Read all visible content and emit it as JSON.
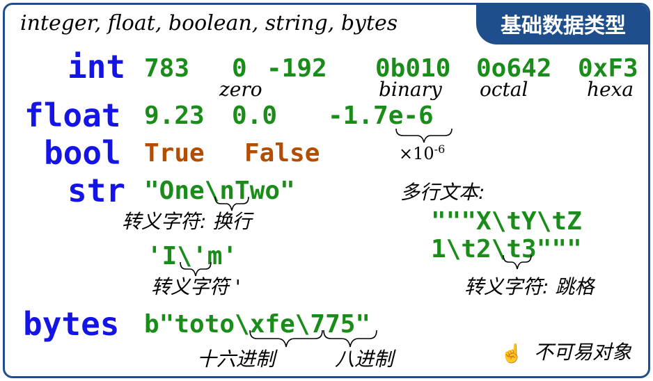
{
  "header": {
    "types_list": "integer, float, boolean, string, bytes",
    "badge": "基础数据类型"
  },
  "int": {
    "keyword": "int",
    "values": [
      "783",
      "0",
      "-192",
      "0b010",
      "0o642",
      "0xF3"
    ],
    "labels": {
      "zero": "zero",
      "binary": "binary",
      "octal": "octal",
      "hexa": "hexa"
    }
  },
  "float": {
    "keyword": "float",
    "values": [
      "9.23",
      "0.0",
      "-1.7e-6"
    ],
    "exp_note": "×10",
    "exp_power": "-6"
  },
  "bool": {
    "keyword": "bool",
    "values": [
      "True",
      "False"
    ]
  },
  "str": {
    "keyword": "str",
    "example1": "\"One\\nTwo\"",
    "note1": "转义字符: 换行",
    "example2": "'I\\'m'",
    "note2": "转义字符 '",
    "multiline_label": "多行文本:",
    "multiline_line1": "\"\"\"X\\tY\\tZ",
    "multiline_line2": "1\\t2\\t3\"\"\"",
    "note3": "转义字符: 跳格"
  },
  "bytes": {
    "keyword": "bytes",
    "value": "b\"toto\\xfe\\775\"",
    "note_hex": "十六进制",
    "note_oct": "八进制",
    "immutable": "不可易对象",
    "pointer_icon": "pointing-hand-icon"
  },
  "colors": {
    "keyword": "#1414e6",
    "value": "#1a8c1a",
    "bool": "#b34d00",
    "frame": "#1f4e8c"
  }
}
